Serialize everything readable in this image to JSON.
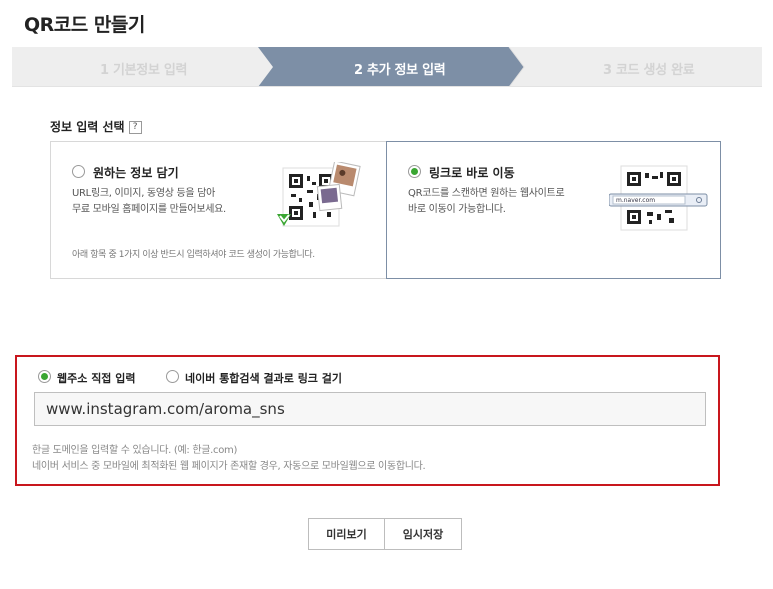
{
  "page_title": "QR코드 만들기",
  "steps": [
    {
      "label": "1 기본정보 입력",
      "state": "done"
    },
    {
      "label": "2 추가 정보 입력",
      "state": "active"
    },
    {
      "label": "3 코드 생성 완료",
      "state": "pending"
    }
  ],
  "info_select": {
    "title": "정보 입력 선택",
    "help": "?"
  },
  "options": {
    "wish_info": {
      "title": "원하는 정보 담기",
      "desc1": "URL링크, 이미지, 동영상 등을 담아",
      "desc2": "무료 모바일 홈페이지를 만들어보세요.",
      "note": "아래 항목 중 1가지 이상 반드시 입력하셔야 코드 생성이 가능합니다.",
      "selected": false
    },
    "link_direct": {
      "title": "링크로 바로 이동",
      "desc1": "QR코드를 스캔하면 원하는 웹사이트로",
      "desc2": "바로 이동이 가능합니다.",
      "url_preview": "m.naver.com",
      "selected": true
    }
  },
  "link_form": {
    "opt_direct": {
      "label": "웹주소 직접 입력",
      "selected": true
    },
    "opt_search": {
      "label": "네이버 통합검색 결과로 링크 걸기",
      "selected": false
    },
    "url_value": "www.instagram.com/aroma_sns",
    "hint1": "한글 도메인을 입력할 수 있습니다. (예: 한글.com)",
    "hint2": "네이버 서비스 중 모바일에 최적화된 웹 페이지가 존재할 경우, 자동으로 모바일웹으로 이동합니다."
  },
  "buttons": {
    "preview": "미리보기",
    "temp_save": "임시저장"
  },
  "colors": {
    "step_active": "#7d8fa6",
    "step_inactive": "#eeeeee",
    "radio_on": "#3aa632",
    "highlight_border": "#c8161d"
  }
}
